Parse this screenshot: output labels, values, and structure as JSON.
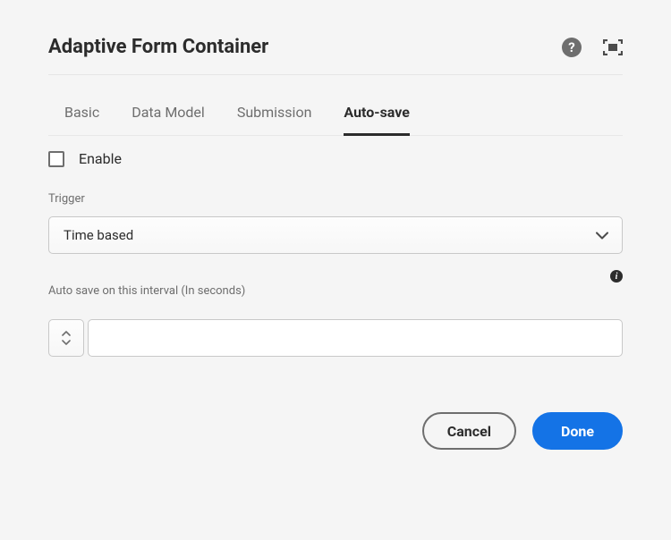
{
  "header": {
    "title": "Adaptive Form Container"
  },
  "tabs": [
    {
      "label": "Basic",
      "active": false
    },
    {
      "label": "Data Model",
      "active": false
    },
    {
      "label": "Submission",
      "active": false
    },
    {
      "label": "Auto-save",
      "active": true
    }
  ],
  "form": {
    "enable_label": "Enable",
    "enable_checked": false,
    "trigger_label": "Trigger",
    "trigger_value": "Time based",
    "interval_label": "Auto save on this interval (In seconds)",
    "interval_value": ""
  },
  "footer": {
    "cancel_label": "Cancel",
    "done_label": "Done"
  }
}
